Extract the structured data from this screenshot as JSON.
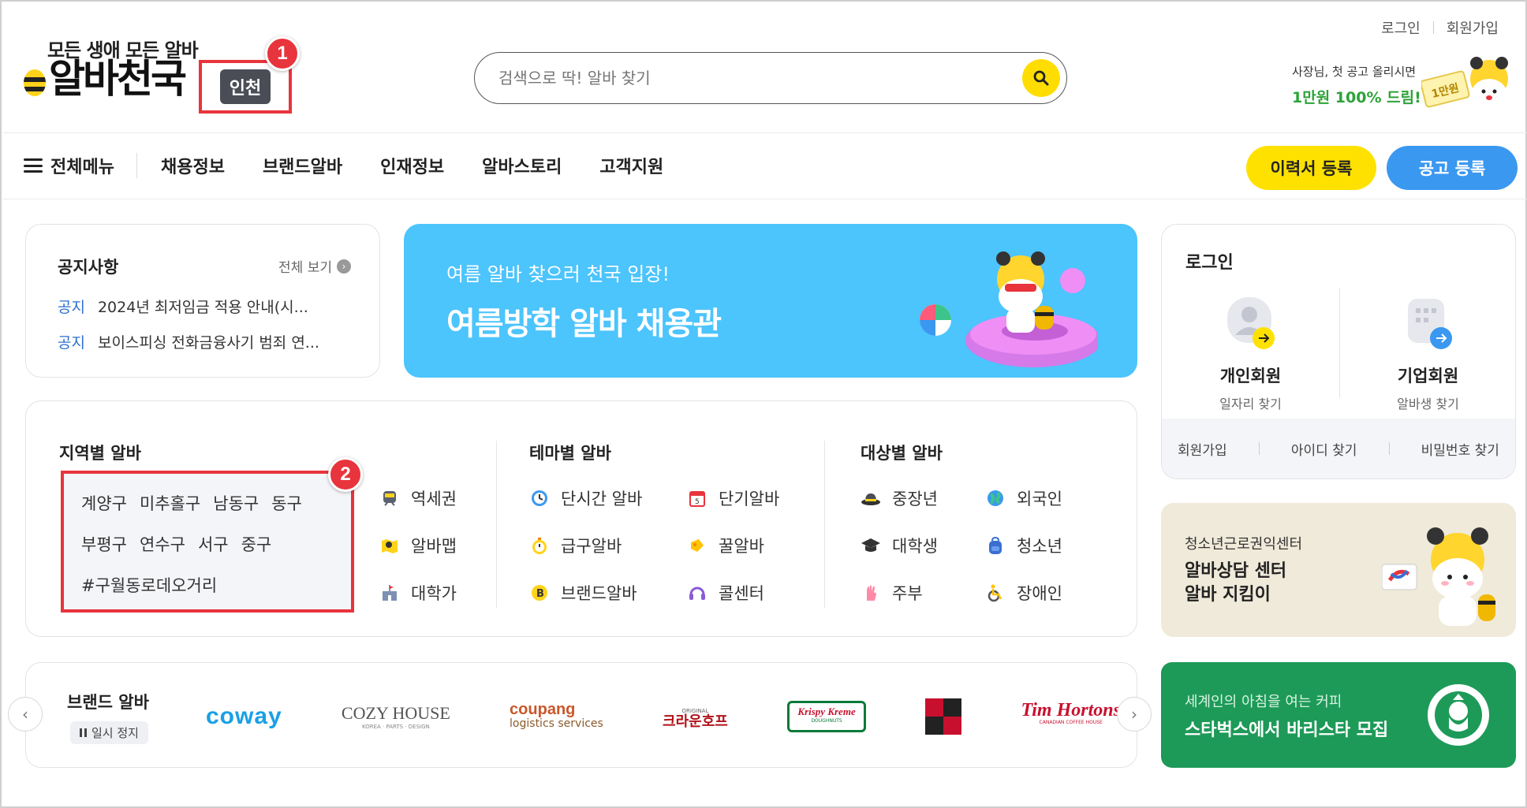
{
  "header": {
    "top_links": [
      "로그인",
      "회원가입"
    ],
    "logo_tagline": "모든 생애 모든 알바",
    "logo_name": "알바천국",
    "region_chip": "인천",
    "search": {
      "placeholder": "검색으로 딱! 알바 찾기"
    },
    "promo": {
      "line1": "사장님, 첫 공고 올리시면",
      "line2": "1만원 100% 드림!",
      "badge": "1만원"
    }
  },
  "callouts": [
    "1",
    "2"
  ],
  "nav": {
    "all_menu": "전체메뉴",
    "items": [
      "채용정보",
      "브랜드알바",
      "인재정보",
      "알바스토리",
      "고객지원"
    ],
    "resume_button": "이력서 등록",
    "post_button": "공고 등록"
  },
  "notice": {
    "title": "공지사항",
    "more": "전체 보기",
    "items": [
      {
        "tag": "공지",
        "text": "2024년 최저임금 적용 안내(시..."
      },
      {
        "tag": "공지",
        "text": "보이스피싱 전화금융사기 범죄 연..."
      }
    ]
  },
  "banner": {
    "subtitle": "여름 알바 찾으러 천국 입장!",
    "title": "여름방학 알바 채용관"
  },
  "login": {
    "title": "로그인",
    "personal": {
      "label": "개인회원",
      "sub": "일자리 찾기"
    },
    "company": {
      "label": "기업회원",
      "sub": "알바생 찾기"
    },
    "footer": [
      "회원가입",
      "아이디 찾기",
      "비밀번호 찾기"
    ]
  },
  "region": {
    "title": "지역별 알바",
    "rows": [
      [
        "계양구",
        "미추홀구",
        "남동구",
        "동구"
      ],
      [
        "부평구",
        "연수구",
        "서구",
        "중구"
      ],
      [
        "#구월동로데오거리"
      ]
    ],
    "extra": [
      {
        "label": "역세권",
        "icon": "train-icon"
      },
      {
        "label": "알바맵",
        "icon": "map-icon"
      },
      {
        "label": "대학가",
        "icon": "campus-icon"
      }
    ]
  },
  "theme": {
    "title": "테마별 알바",
    "col1": [
      {
        "label": "단시간 알바",
        "icon": "clock-icon"
      },
      {
        "label": "급구알바",
        "icon": "stopwatch-icon"
      },
      {
        "label": "브랜드알바",
        "icon": "brand-b-icon"
      }
    ],
    "col2": [
      {
        "label": "단기알바",
        "icon": "calendar-icon",
        "num": "5"
      },
      {
        "label": "꿀알바",
        "icon": "honey-icon"
      },
      {
        "label": "콜센터",
        "icon": "headset-icon"
      }
    ]
  },
  "target": {
    "title": "대상별 알바",
    "col1": [
      {
        "label": "중장년",
        "icon": "hat-icon"
      },
      {
        "label": "대학생",
        "icon": "graduation-cap-icon"
      },
      {
        "label": "주부",
        "icon": "rubber-glove-icon"
      }
    ],
    "col2": [
      {
        "label": "외국인",
        "icon": "globe-icon"
      },
      {
        "label": "청소년",
        "icon": "backpack-icon"
      },
      {
        "label": "장애인",
        "icon": "wheelchair-icon"
      }
    ]
  },
  "center": {
    "line1": "청소년근로권익센터",
    "line2": "알바상담 센터",
    "line3": "알바 지킴이"
  },
  "brands": {
    "title": "브랜드 알바",
    "pause": "일시 정지",
    "logos": [
      "coway",
      "COZY HOUSE",
      "coupang",
      "logistics services",
      "크라운호프",
      "Krispy Kreme",
      "Tim Hortons"
    ],
    "cozy_sub": "KOREA · PARTS · DESIGN",
    "crown_top": "ORIGINAL",
    "krispy_sub": "DOUGHNUTS",
    "tim_sub": "CANADIAN COFFEE HOUSE"
  },
  "starbucks": {
    "line1": "세계인의 아침을 여는 커피",
    "line2": "스타벅스에서 바리스타 모집"
  },
  "colors": {
    "accent_yellow": "#ffe100",
    "accent_blue": "#3a98f0",
    "callout_red": "#e8343c",
    "banner_blue": "#4cc4fc",
    "starbucks_green": "#1e9a58"
  }
}
